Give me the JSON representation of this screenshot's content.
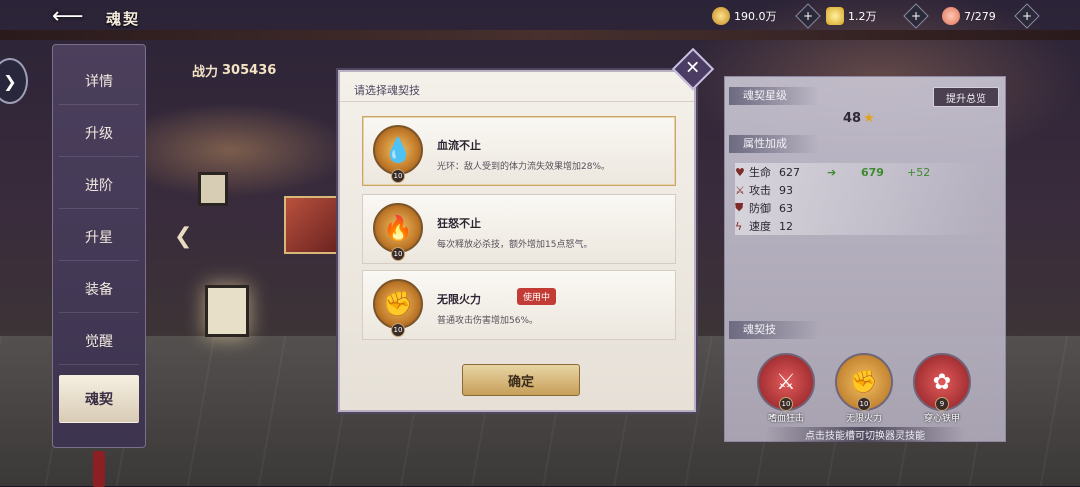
{
  "header": {
    "title": "魂契",
    "resources": [
      {
        "icon": "gold-coin-icon",
        "value": "190.0万"
      },
      {
        "icon": "gold-ingot-icon",
        "value": "1.2万"
      },
      {
        "icon": "peach-icon",
        "value": "7/279"
      }
    ]
  },
  "nav": {
    "items": [
      {
        "label": "详情"
      },
      {
        "label": "升级"
      },
      {
        "label": "进阶"
      },
      {
        "label": "升星"
      },
      {
        "label": "装备"
      },
      {
        "label": "觉醒"
      },
      {
        "label": "魂契",
        "active": true
      }
    ]
  },
  "power": {
    "label": "战力",
    "value": "305436"
  },
  "modal": {
    "title": "请选择魂契技",
    "skills": [
      {
        "name": "血流不止",
        "desc": "光环：敌人受到的体力流失效果增加28%。",
        "level": "10",
        "icon": "blood-drop-icon",
        "glyph": "💧"
      },
      {
        "name": "狂怒不止",
        "desc": "每次释放必杀技，额外增加15点怒气。",
        "level": "10",
        "icon": "flame-icon",
        "glyph": "🔥"
      },
      {
        "name": "无限火力",
        "desc": "普通攻击伤害增加56%。",
        "level": "10",
        "icon": "fist-icon",
        "glyph": "✊",
        "badge": "使用中"
      }
    ],
    "confirm": "确定"
  },
  "panel": {
    "star_title": "魂契星级",
    "upgrade_label": "提升总览",
    "star_value": "48",
    "attr_title": "属性加成",
    "attrs": [
      {
        "name": "生命",
        "value": "627",
        "new": "679",
        "diff": "+52",
        "icon": "heart-icon"
      },
      {
        "name": "攻击",
        "value": "93",
        "icon": "sword-icon"
      },
      {
        "name": "防御",
        "value": "63",
        "icon": "shield-icon"
      },
      {
        "name": "速度",
        "value": "12",
        "icon": "lightning-icon"
      }
    ],
    "skill_title": "魂契技",
    "slots": [
      {
        "label": "嗜血狂击",
        "level": "10",
        "icon": "claw-icon",
        "glyph": "⚔"
      },
      {
        "label": "无限火力",
        "level": "10",
        "icon": "fist-icon",
        "glyph": "✊"
      },
      {
        "label": "穿心铁甲",
        "level": "9",
        "icon": "rose-icon",
        "glyph": "✿"
      }
    ],
    "hint": "点击技能槽可切换器灵技能"
  },
  "colors": {
    "accent": "#c33b35",
    "gold": "#c79f59",
    "panel": "#b0aaba",
    "nav_bg": "#4b3f5c"
  }
}
